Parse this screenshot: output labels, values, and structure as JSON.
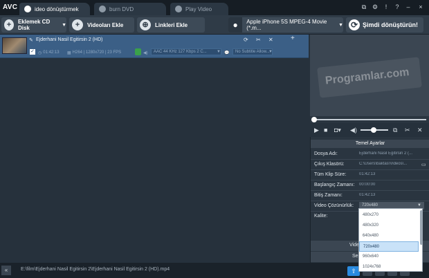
{
  "app": {
    "logo": "AVC"
  },
  "tabs": [
    {
      "label": "ideo dönüştürmek"
    },
    {
      "label": "burn DVD"
    },
    {
      "label": "Play Video"
    }
  ],
  "window_controls": [
    "⧉",
    "⚙",
    "!",
    "?",
    "–",
    "×"
  ],
  "toolbar": {
    "add_cd": "Eklemek CD Disk",
    "add_video": "Videoları Ekle",
    "add_links": "Linkleri Ekle",
    "profile": "Apple iPhone 5S MPEG-4 Movie (*.m...",
    "convert": "Şimdi dönüştürün!"
  },
  "file": {
    "name": "Ejderhani Nasil Egitirsin 2 (HD)",
    "duration": "01:42:13",
    "codec_res_fps": "H264 | 1280x720 | 23 FPS",
    "audio": "AAC 44 KHz 127 Kbps 2 C...",
    "subtitle": "No Subtitle Allow..."
  },
  "preview": {
    "watermark": "Programlar.com"
  },
  "settings": {
    "header": "Temel Ayarlar",
    "rows": [
      {
        "label": "Dosya Adı:",
        "value": "Ejderhani Nasil Egitirsin 2 (..."
      },
      {
        "label": "Çıkış Klasörü:",
        "value": "C:\\Users\\baktas\\Videos\\..."
      },
      {
        "label": "Tüm Klip Süre:",
        "value": "01:42:13"
      },
      {
        "label": "Başlangıç Zamanı:",
        "value": "00:00:00"
      },
      {
        "label": "Bitiş Zamanı:",
        "value": "01:42:13"
      }
    ],
    "resolution_label": "Video Çözünürlük:",
    "resolution_value": "720x480",
    "quality_label": "Kalite:",
    "partial_video": "Vide",
    "partial_audio": "Ses"
  },
  "resolution_options": [
    "480x270",
    "480x320",
    "640x480",
    "720x480",
    "960x640",
    "1024x768"
  ],
  "status": {
    "path": "E:\\film\\Ejderhani Nasil Egitirsin 2\\Ejderhani Nasil Egitirsin 2 (HD).mp4"
  }
}
